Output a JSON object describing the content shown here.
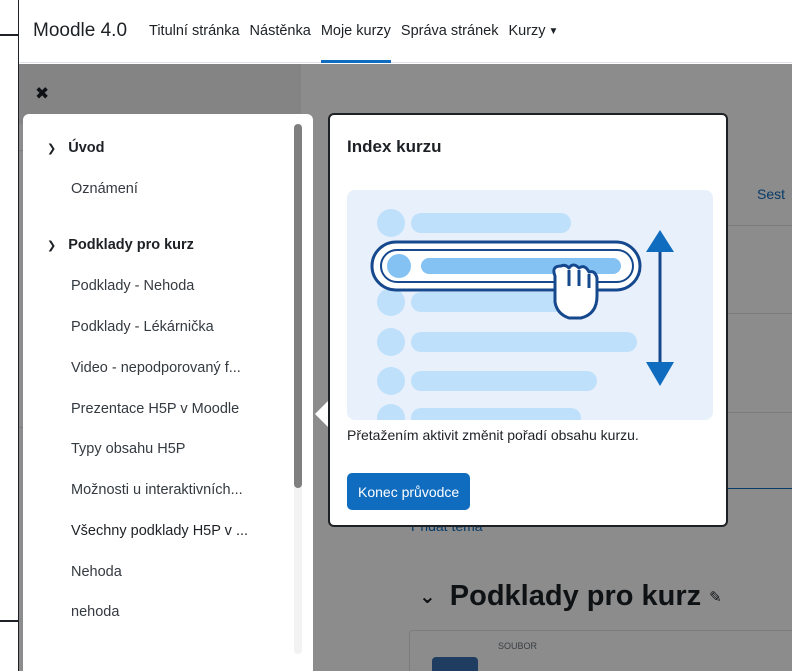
{
  "navbar": {
    "brand": "Moodle 4.0",
    "links": [
      "Titulní stránka",
      "Nástěnka",
      "Moje kurzy",
      "Správa stránek",
      "Kurzy"
    ],
    "active_link": "Moje kurzy",
    "accent_color": "#0f6cbf"
  },
  "drawer": {
    "close_icon": "close-icon"
  },
  "course_index": {
    "sections": [
      {
        "title": "Úvod",
        "items": [
          "Oznámení"
        ]
      },
      {
        "title": "Podklady pro kurz",
        "items": [
          "Podklady - Nehoda",
          "Podklady - Lékárnička",
          "Video - nepodporovaný f...",
          "Prezentace H5P v Moodle",
          "Typy obsahu H5P",
          "Možnosti u interaktivních...",
          "Všechny podklady H5P v ...",
          "Nehoda",
          "nehoda"
        ]
      }
    ]
  },
  "tour": {
    "title": "Index kurzu",
    "text": "Přetažením aktivit změnit pořadí obsahu kurzu.",
    "end_button": "Konec průvodce"
  },
  "background": {
    "right_truncated": "Sest",
    "add_topic": "Přidat téma",
    "section_heading": "Podklady pro kurz",
    "activity_kind": "SOUBOR"
  }
}
